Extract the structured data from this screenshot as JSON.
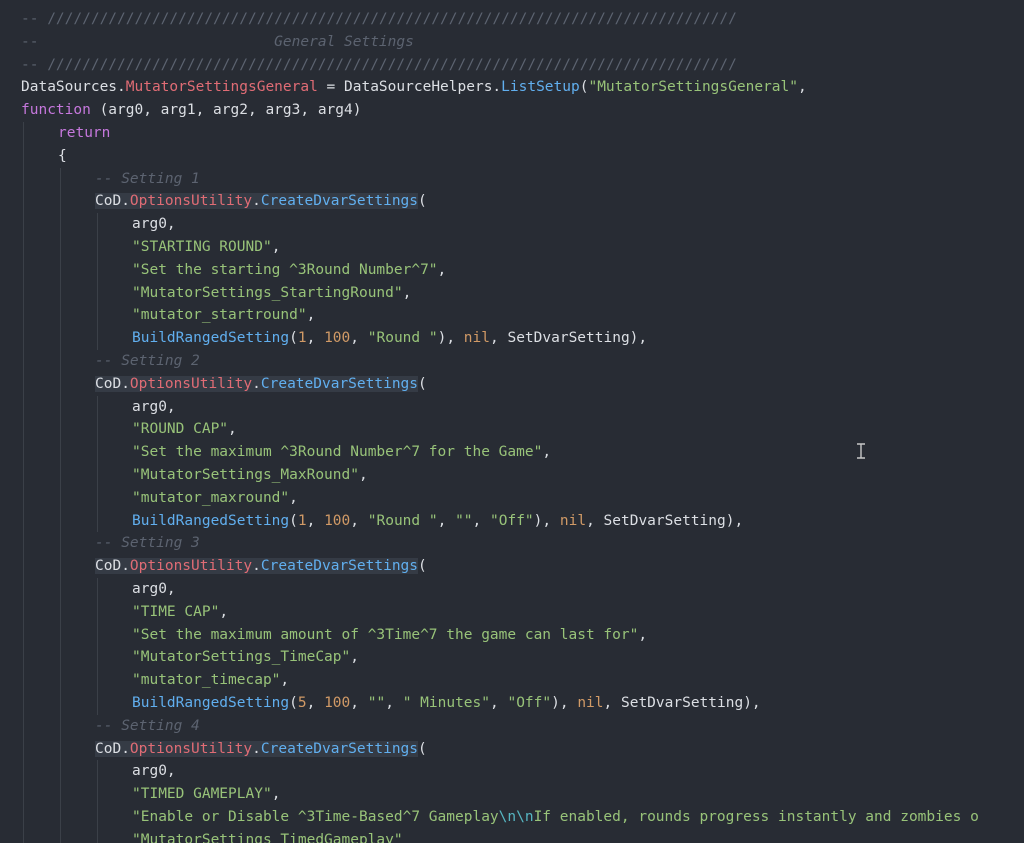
{
  "colors": {
    "background": "#282c34",
    "comment": "#5c6370",
    "plain": "#dcdfe4",
    "keyword": "#c678dd",
    "string": "#98c379",
    "number": "#d19a66",
    "function": "#61afef",
    "field": "#e06c75",
    "escape": "#56b6c2"
  },
  "editor": {
    "language": "lua",
    "lines": [
      {
        "indent": 0,
        "tokens": [
          {
            "t": "-- ///////////////////////////////////////////////////////////////////////////////",
            "c": "comment"
          }
        ]
      },
      {
        "indent": 0,
        "tokens": [
          {
            "t": "--                           ",
            "c": "comment"
          },
          {
            "t": "General Settings",
            "c": "comment-italic"
          }
        ]
      },
      {
        "indent": 0,
        "tokens": [
          {
            "t": "-- ///////////////////////////////////////////////////////////////////////////////",
            "c": "comment"
          }
        ]
      },
      {
        "indent": 0,
        "tokens": [
          {
            "t": "DataSources.",
            "c": "plain"
          },
          {
            "t": "MutatorSettingsGeneral",
            "c": "field"
          },
          {
            "t": " = DataSourceHelpers.",
            "c": "plain"
          },
          {
            "t": "ListSetup",
            "c": "func"
          },
          {
            "t": "(",
            "c": "plain"
          },
          {
            "t": "\"MutatorSettingsGeneral\"",
            "c": "string"
          },
          {
            "t": ",",
            "c": "plain"
          }
        ]
      },
      {
        "indent": 0,
        "tokens": [
          {
            "t": "function",
            "c": "keyword"
          },
          {
            "t": " (arg0, arg1, arg2, arg3, arg4)",
            "c": "plain"
          }
        ]
      },
      {
        "indent": 1,
        "tokens": [
          {
            "t": "return",
            "c": "keyword"
          }
        ]
      },
      {
        "indent": 1,
        "tokens": [
          {
            "t": "{",
            "c": "plain"
          }
        ]
      },
      {
        "indent": 2,
        "tokens": [
          {
            "t": "-- Setting 1",
            "c": "comment-italic"
          }
        ]
      },
      {
        "indent": 2,
        "tokens": [
          {
            "t": "CoD.",
            "c": "plain",
            "hl": true
          },
          {
            "t": "OptionsUtility",
            "c": "field",
            "hl": true
          },
          {
            "t": ".",
            "c": "plain",
            "hl": true
          },
          {
            "t": "CreateDvarSettings",
            "c": "func",
            "hl": true
          },
          {
            "t": "(",
            "c": "plain"
          }
        ]
      },
      {
        "indent": 3,
        "tokens": [
          {
            "t": "arg0,",
            "c": "plain"
          }
        ]
      },
      {
        "indent": 3,
        "tokens": [
          {
            "t": "\"STARTING ROUND\"",
            "c": "string"
          },
          {
            "t": ",",
            "c": "plain"
          }
        ]
      },
      {
        "indent": 3,
        "tokens": [
          {
            "t": "\"Set the starting ^3Round Number^7\"",
            "c": "string"
          },
          {
            "t": ",",
            "c": "plain"
          }
        ]
      },
      {
        "indent": 3,
        "tokens": [
          {
            "t": "\"MutatorSettings_StartingRound\"",
            "c": "string"
          },
          {
            "t": ",",
            "c": "plain"
          }
        ]
      },
      {
        "indent": 3,
        "tokens": [
          {
            "t": "\"mutator_startround\"",
            "c": "string"
          },
          {
            "t": ",",
            "c": "plain"
          }
        ]
      },
      {
        "indent": 3,
        "tokens": [
          {
            "t": "BuildRangedSetting",
            "c": "func"
          },
          {
            "t": "(",
            "c": "plain"
          },
          {
            "t": "1",
            "c": "number"
          },
          {
            "t": ", ",
            "c": "plain"
          },
          {
            "t": "100",
            "c": "number"
          },
          {
            "t": ", ",
            "c": "plain"
          },
          {
            "t": "\"Round \"",
            "c": "string"
          },
          {
            "t": "), ",
            "c": "plain"
          },
          {
            "t": "nil",
            "c": "nil"
          },
          {
            "t": ", SetDvarSetting),",
            "c": "plain"
          }
        ]
      },
      {
        "indent": 2,
        "tokens": [
          {
            "t": "-- Setting 2",
            "c": "comment-italic"
          }
        ]
      },
      {
        "indent": 2,
        "tokens": [
          {
            "t": "CoD.",
            "c": "plain",
            "hl": true
          },
          {
            "t": "OptionsUtility",
            "c": "field",
            "hl": true
          },
          {
            "t": ".",
            "c": "plain",
            "hl": true
          },
          {
            "t": "CreateDvarSettings",
            "c": "func",
            "hl": true
          },
          {
            "t": "(",
            "c": "plain"
          }
        ]
      },
      {
        "indent": 3,
        "tokens": [
          {
            "t": "arg0,",
            "c": "plain"
          }
        ]
      },
      {
        "indent": 3,
        "tokens": [
          {
            "t": "\"ROUND CAP\"",
            "c": "string"
          },
          {
            "t": ",",
            "c": "plain"
          }
        ]
      },
      {
        "indent": 3,
        "tokens": [
          {
            "t": "\"Set the maximum ^3Round Number^7 for the Game\"",
            "c": "string"
          },
          {
            "t": ",",
            "c": "plain"
          }
        ]
      },
      {
        "indent": 3,
        "tokens": [
          {
            "t": "\"MutatorSettings_MaxRound\"",
            "c": "string"
          },
          {
            "t": ",",
            "c": "plain"
          }
        ]
      },
      {
        "indent": 3,
        "tokens": [
          {
            "t": "\"mutator_maxround\"",
            "c": "string"
          },
          {
            "t": ",",
            "c": "plain"
          }
        ]
      },
      {
        "indent": 3,
        "tokens": [
          {
            "t": "BuildRangedSetting",
            "c": "func"
          },
          {
            "t": "(",
            "c": "plain"
          },
          {
            "t": "1",
            "c": "number"
          },
          {
            "t": ", ",
            "c": "plain"
          },
          {
            "t": "100",
            "c": "number"
          },
          {
            "t": ", ",
            "c": "plain"
          },
          {
            "t": "\"Round \"",
            "c": "string"
          },
          {
            "t": ", ",
            "c": "plain"
          },
          {
            "t": "\"\"",
            "c": "string"
          },
          {
            "t": ", ",
            "c": "plain"
          },
          {
            "t": "\"Off\"",
            "c": "string"
          },
          {
            "t": "), ",
            "c": "plain"
          },
          {
            "t": "nil",
            "c": "nil"
          },
          {
            "t": ", SetDvarSetting),",
            "c": "plain"
          }
        ]
      },
      {
        "indent": 2,
        "tokens": [
          {
            "t": "-- Setting 3",
            "c": "comment-italic"
          }
        ]
      },
      {
        "indent": 2,
        "tokens": [
          {
            "t": "CoD.",
            "c": "plain",
            "hl": true
          },
          {
            "t": "OptionsUtility",
            "c": "field",
            "hl": true
          },
          {
            "t": ".",
            "c": "plain",
            "hl": true
          },
          {
            "t": "CreateDvarSettings",
            "c": "func",
            "hl": true
          },
          {
            "t": "(",
            "c": "plain"
          }
        ]
      },
      {
        "indent": 3,
        "tokens": [
          {
            "t": "arg0,",
            "c": "plain"
          }
        ]
      },
      {
        "indent": 3,
        "tokens": [
          {
            "t": "\"TIME CAP\"",
            "c": "string"
          },
          {
            "t": ",",
            "c": "plain"
          }
        ]
      },
      {
        "indent": 3,
        "tokens": [
          {
            "t": "\"Set the maximum amount of ^3Time^7 the game can last for\"",
            "c": "string"
          },
          {
            "t": ",",
            "c": "plain"
          }
        ]
      },
      {
        "indent": 3,
        "tokens": [
          {
            "t": "\"MutatorSettings_TimeCap\"",
            "c": "string"
          },
          {
            "t": ",",
            "c": "plain"
          }
        ]
      },
      {
        "indent": 3,
        "tokens": [
          {
            "t": "\"mutator_timecap\"",
            "c": "string"
          },
          {
            "t": ",",
            "c": "plain"
          }
        ]
      },
      {
        "indent": 3,
        "tokens": [
          {
            "t": "BuildRangedSetting",
            "c": "func"
          },
          {
            "t": "(",
            "c": "plain"
          },
          {
            "t": "5",
            "c": "number"
          },
          {
            "t": ", ",
            "c": "plain"
          },
          {
            "t": "100",
            "c": "number"
          },
          {
            "t": ", ",
            "c": "plain"
          },
          {
            "t": "\"\"",
            "c": "string"
          },
          {
            "t": ", ",
            "c": "plain"
          },
          {
            "t": "\" Minutes\"",
            "c": "string"
          },
          {
            "t": ", ",
            "c": "plain"
          },
          {
            "t": "\"Off\"",
            "c": "string"
          },
          {
            "t": "), ",
            "c": "plain"
          },
          {
            "t": "nil",
            "c": "nil"
          },
          {
            "t": ", SetDvarSetting),",
            "c": "plain"
          }
        ]
      },
      {
        "indent": 2,
        "tokens": [
          {
            "t": "-- Setting 4",
            "c": "comment-italic"
          }
        ]
      },
      {
        "indent": 2,
        "tokens": [
          {
            "t": "CoD.",
            "c": "plain",
            "hl": true
          },
          {
            "t": "OptionsUtility",
            "c": "field",
            "hl": true
          },
          {
            "t": ".",
            "c": "plain",
            "hl": true
          },
          {
            "t": "CreateDvarSettings",
            "c": "func",
            "hl": true
          },
          {
            "t": "(",
            "c": "plain"
          }
        ]
      },
      {
        "indent": 3,
        "tokens": [
          {
            "t": "arg0,",
            "c": "plain"
          }
        ]
      },
      {
        "indent": 3,
        "tokens": [
          {
            "t": "\"TIMED GAMEPLAY\"",
            "c": "string"
          },
          {
            "t": ",",
            "c": "plain"
          }
        ]
      },
      {
        "indent": 3,
        "tokens": [
          {
            "t": "\"Enable or Disable ^3Time-Based^7 Gameplay",
            "c": "string"
          },
          {
            "t": "\\n\\n",
            "c": "escape"
          },
          {
            "t": "If enabled, rounds progress instantly and zombies o",
            "c": "string"
          }
        ]
      },
      {
        "indent": 3,
        "tokens": [
          {
            "t": "\"MutatorSettings_TimedGameplay\"",
            "c": "string"
          }
        ]
      }
    ]
  },
  "cursor": {
    "icon": "text-cursor-icon"
  }
}
